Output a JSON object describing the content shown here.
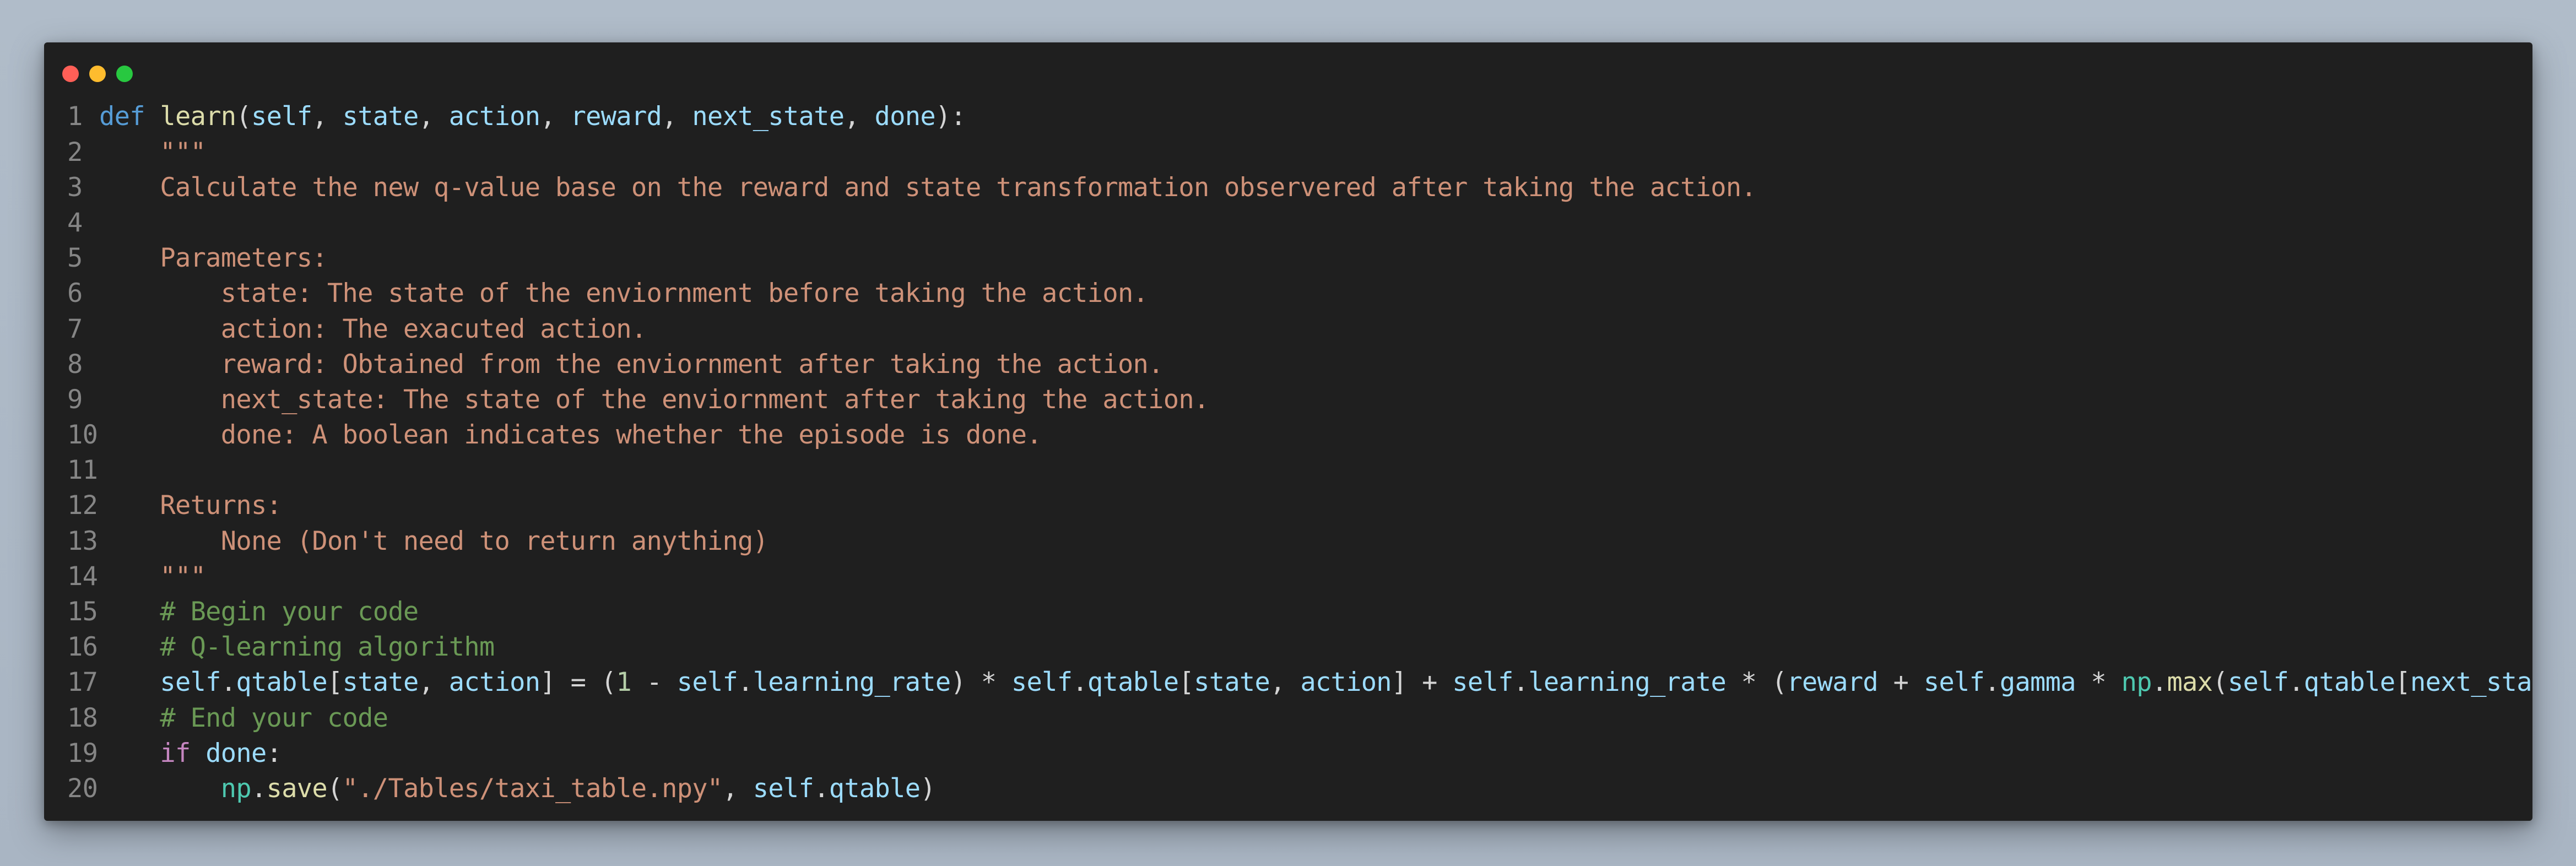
{
  "window": {
    "controls": [
      "close-button",
      "minimize-button",
      "maximize-button"
    ]
  },
  "colors": {
    "keyword": "#569cd6",
    "control": "#c586c0",
    "function": "#dcdcaa",
    "variable": "#9cdcfe",
    "module": "#4ec9b0",
    "string": "#ce9178",
    "comment": "#6a9955",
    "number": "#b5cea8",
    "plain": "#d4d4d4",
    "line_number": "#858585",
    "editor_background": "#1f1f1f"
  },
  "code": {
    "lines": [
      {
        "number": "1",
        "tokens": [
          {
            "t": "def",
            "k": "keyword"
          },
          {
            "t": " ",
            "k": "plain"
          },
          {
            "t": "learn",
            "k": "function"
          },
          {
            "t": "(",
            "k": "plain"
          },
          {
            "t": "self",
            "k": "variable"
          },
          {
            "t": ", ",
            "k": "plain"
          },
          {
            "t": "state",
            "k": "variable"
          },
          {
            "t": ", ",
            "k": "plain"
          },
          {
            "t": "action",
            "k": "variable"
          },
          {
            "t": ", ",
            "k": "plain"
          },
          {
            "t": "reward",
            "k": "variable"
          },
          {
            "t": ", ",
            "k": "plain"
          },
          {
            "t": "next_state",
            "k": "variable"
          },
          {
            "t": ", ",
            "k": "plain"
          },
          {
            "t": "done",
            "k": "variable"
          },
          {
            "t": "):",
            "k": "plain"
          }
        ]
      },
      {
        "number": "2",
        "tokens": [
          {
            "t": "    \"\"\"",
            "k": "string"
          }
        ]
      },
      {
        "number": "3",
        "tokens": [
          {
            "t": "    Calculate the new q-value base on the reward and state transformation observered after taking the action.",
            "k": "string"
          }
        ]
      },
      {
        "number": "4",
        "tokens": []
      },
      {
        "number": "5",
        "tokens": [
          {
            "t": "    Parameters:",
            "k": "string"
          }
        ]
      },
      {
        "number": "6",
        "tokens": [
          {
            "t": "        state: The state of the enviornment before taking the action.",
            "k": "string"
          }
        ]
      },
      {
        "number": "7",
        "tokens": [
          {
            "t": "        action: The exacuted action.",
            "k": "string"
          }
        ]
      },
      {
        "number": "8",
        "tokens": [
          {
            "t": "        reward: Obtained from the enviornment after taking the action.",
            "k": "string"
          }
        ]
      },
      {
        "number": "9",
        "tokens": [
          {
            "t": "        next_state: The state of the enviornment after taking the action.",
            "k": "string"
          }
        ]
      },
      {
        "number": "10",
        "tokens": [
          {
            "t": "        done: A boolean indicates whether the episode is done.",
            "k": "string"
          }
        ]
      },
      {
        "number": "11",
        "tokens": []
      },
      {
        "number": "12",
        "tokens": [
          {
            "t": "    Returns:",
            "k": "string"
          }
        ]
      },
      {
        "number": "13",
        "tokens": [
          {
            "t": "        None (Don't need to return anything)",
            "k": "string"
          }
        ]
      },
      {
        "number": "14",
        "tokens": [
          {
            "t": "    \"\"\"",
            "k": "string"
          }
        ]
      },
      {
        "number": "15",
        "tokens": [
          {
            "t": "    # Begin your code",
            "k": "comment"
          }
        ]
      },
      {
        "number": "16",
        "tokens": [
          {
            "t": "    # Q-learning algorithm",
            "k": "comment"
          }
        ]
      },
      {
        "number": "17",
        "tokens": [
          {
            "t": "    ",
            "k": "plain"
          },
          {
            "t": "self",
            "k": "variable"
          },
          {
            "t": ".",
            "k": "plain"
          },
          {
            "t": "qtable",
            "k": "variable"
          },
          {
            "t": "[",
            "k": "plain"
          },
          {
            "t": "state",
            "k": "variable"
          },
          {
            "t": ", ",
            "k": "plain"
          },
          {
            "t": "action",
            "k": "variable"
          },
          {
            "t": "] = (",
            "k": "plain"
          },
          {
            "t": "1",
            "k": "number"
          },
          {
            "t": " - ",
            "k": "plain"
          },
          {
            "t": "self",
            "k": "variable"
          },
          {
            "t": ".",
            "k": "plain"
          },
          {
            "t": "learning_rate",
            "k": "variable"
          },
          {
            "t": ") * ",
            "k": "plain"
          },
          {
            "t": "self",
            "k": "variable"
          },
          {
            "t": ".",
            "k": "plain"
          },
          {
            "t": "qtable",
            "k": "variable"
          },
          {
            "t": "[",
            "k": "plain"
          },
          {
            "t": "state",
            "k": "variable"
          },
          {
            "t": ", ",
            "k": "plain"
          },
          {
            "t": "action",
            "k": "variable"
          },
          {
            "t": "] + ",
            "k": "plain"
          },
          {
            "t": "self",
            "k": "variable"
          },
          {
            "t": ".",
            "k": "plain"
          },
          {
            "t": "learning_rate",
            "k": "variable"
          },
          {
            "t": " * (",
            "k": "plain"
          },
          {
            "t": "reward",
            "k": "variable"
          },
          {
            "t": " + ",
            "k": "plain"
          },
          {
            "t": "self",
            "k": "variable"
          },
          {
            "t": ".",
            "k": "plain"
          },
          {
            "t": "gamma",
            "k": "variable"
          },
          {
            "t": " * ",
            "k": "plain"
          },
          {
            "t": "np",
            "k": "module"
          },
          {
            "t": ".",
            "k": "plain"
          },
          {
            "t": "max",
            "k": "function"
          },
          {
            "t": "(",
            "k": "plain"
          },
          {
            "t": "self",
            "k": "variable"
          },
          {
            "t": ".",
            "k": "plain"
          },
          {
            "t": "qtable",
            "k": "variable"
          },
          {
            "t": "[",
            "k": "plain"
          },
          {
            "t": "next_state",
            "k": "variable"
          },
          {
            "t": "]))",
            "k": "plain"
          }
        ]
      },
      {
        "number": "18",
        "tokens": [
          {
            "t": "    # End your code",
            "k": "comment"
          }
        ]
      },
      {
        "number": "19",
        "tokens": [
          {
            "t": "    ",
            "k": "plain"
          },
          {
            "t": "if",
            "k": "control"
          },
          {
            "t": " ",
            "k": "plain"
          },
          {
            "t": "done",
            "k": "variable"
          },
          {
            "t": ":",
            "k": "plain"
          }
        ]
      },
      {
        "number": "20",
        "tokens": [
          {
            "t": "        ",
            "k": "plain"
          },
          {
            "t": "np",
            "k": "module"
          },
          {
            "t": ".",
            "k": "plain"
          },
          {
            "t": "save",
            "k": "function"
          },
          {
            "t": "(",
            "k": "plain"
          },
          {
            "t": "\"./Tables/taxi_table.npy\"",
            "k": "string"
          },
          {
            "t": ", ",
            "k": "plain"
          },
          {
            "t": "self",
            "k": "variable"
          },
          {
            "t": ".",
            "k": "plain"
          },
          {
            "t": "qtable",
            "k": "variable"
          },
          {
            "t": ")",
            "k": "plain"
          }
        ]
      }
    ]
  }
}
